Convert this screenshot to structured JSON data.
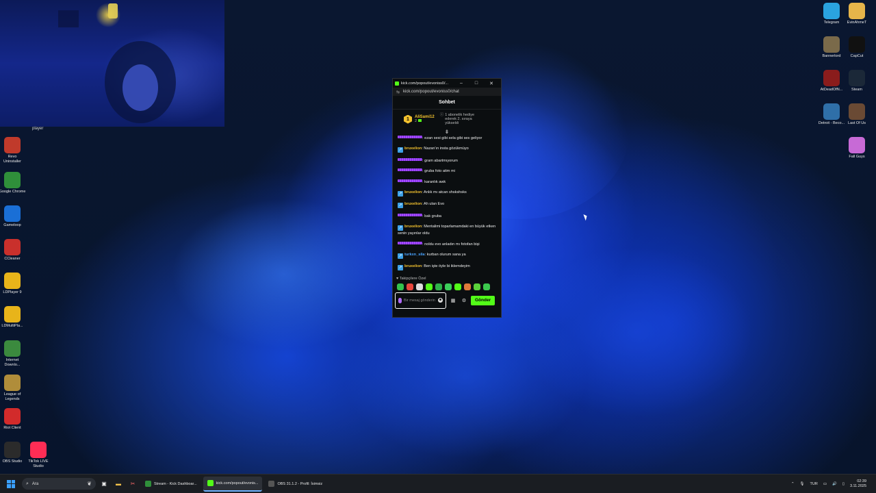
{
  "webcam": {
    "label": "player"
  },
  "desktop_left": [
    {
      "label": "Revo Uninstaller",
      "icon": "revo-icon",
      "color": "#c03a2b"
    },
    {
      "label": "Google Chrome",
      "icon": "chrome-icon",
      "color": "#2f8f3a"
    },
    {
      "label": "Gameloop",
      "icon": "gameloop-icon",
      "color": "#1a6fd6"
    },
    {
      "label": "CCleaner",
      "icon": "ccleaner-icon",
      "color": "#c9302c"
    },
    {
      "label": "LDPlayer 9",
      "icon": "ldplayer-icon",
      "color": "#e8b41a"
    },
    {
      "label": "LDMultiPla...",
      "icon": "ldmultiplayer-icon",
      "color": "#e8b41a"
    },
    {
      "label": "Internet Downlo...",
      "icon": "idm-icon",
      "color": "#3b8a3e"
    },
    {
      "label": "League of Legends",
      "icon": "lol-icon",
      "color": "#b08d3a"
    },
    {
      "label": "Riot Client",
      "icon": "riot-icon",
      "color": "#d22b2b"
    },
    {
      "label": "OBS Studio",
      "icon": "obs-icon",
      "color": "#2b2b2b"
    },
    {
      "label": "TikTok LIVE Studio",
      "icon": "tiktok-icon",
      "color": "#ff2d55"
    }
  ],
  "desktop_right": [
    {
      "label": "Telegram",
      "icon": "telegram-icon",
      "color": "#2aa3df"
    },
    {
      "label": "EvinAhmeT",
      "icon": "folder-icon",
      "color": "#e6b54a"
    },
    {
      "label": "Bannerlord",
      "icon": "bannerlord-icon",
      "color": "#7a6a4a"
    },
    {
      "label": "CapCut",
      "icon": "capcut-icon",
      "color": "#111111"
    },
    {
      "label": "AtDeadOfN...",
      "icon": "atdeadofnight-icon",
      "color": "#8a1c1c"
    },
    {
      "label": "Steam",
      "icon": "steam-icon",
      "color": "#1b2838"
    },
    {
      "label": "Detroit - Beco...",
      "icon": "detroit-icon",
      "color": "#2f6fa8"
    },
    {
      "label": "Last Of Us",
      "icon": "lastofus-icon",
      "color": "#6a4a34"
    },
    {
      "label": "Fall Guys",
      "icon": "fallguys-icon",
      "color": "#c76ad6"
    }
  ],
  "chat": {
    "window_title": "kick.com/popout/evoniss0/...",
    "url": "kick.com/popout/evoniss0/chat",
    "header": "Sohbet",
    "pinned": {
      "user": "AliSami12",
      "level": "2",
      "badge": "1",
      "text": "1 abonelik hediye ederek 2. sıraya yükseldi"
    },
    "messages": [
      {
        "user": "",
        "style": "purple",
        "text": ": ezan sesi gibi sela gibi ses geliyor"
      },
      {
        "user": "bruxelion",
        "style": "gold",
        "text": ": Nazan'ın insta gözükmüyo"
      },
      {
        "user": "",
        "style": "purple",
        "text": ": gram abartmıyorum"
      },
      {
        "user": "",
        "style": "purple",
        "text": ": gruba foto atim mi"
      },
      {
        "user": "",
        "style": "purple",
        "text": ": karanlık awk"
      },
      {
        "user": "bruxelion",
        "style": "gold",
        "text": ": Anlık mı atcan shskshsks"
      },
      {
        "user": "bruxelion",
        "style": "gold",
        "text": ": Ah ulan Evo"
      },
      {
        "user": "",
        "style": "purple",
        "text": ": bak gruba"
      },
      {
        "user": "bruxelion",
        "style": "gold",
        "text": ": Mentalimi toparlamamdaki en büyük etken senin yayınlar oldu"
      },
      {
        "user": "",
        "style": "purple",
        "text": ": noldu evo anladın mı fotofan bişi"
      },
      {
        "user": "turkxn_sila",
        "style": "blue",
        "text": ": kurban olurum sana ya"
      },
      {
        "user": "bruxelion",
        "style": "gold",
        "text": ": Ben işte öyle bi iklemdeyim"
      }
    ],
    "follower_only": "Takipçilere Özel",
    "emote_colors": [
      "#33c24d",
      "#e8453c",
      "#dddddd",
      "#53fc18",
      "#2fb34a",
      "#3ccf5a",
      "#53fc18",
      "#e07a3a",
      "#5ad13a",
      "#3cc84d"
    ],
    "input_placeholder": "Bir mesaj gönderin",
    "send_label": "Gönder"
  },
  "taskbar": {
    "search_placeholder": "Ara",
    "apps": [
      {
        "label": "Stream - Kick Dashboar...",
        "icon": "chrome-icon",
        "color": "#2f8f3a",
        "active": false
      },
      {
        "label": "kick.com/popout/evonis...",
        "icon": "kick-icon",
        "color": "#53fc18",
        "active": true
      },
      {
        "label": "OBS 31.1.2 - Profil: İsimsiz",
        "icon": "obs-icon",
        "color": "#555555",
        "active": false
      }
    ],
    "language": "TUR",
    "time": "02:39",
    "date": "3.11.2025"
  }
}
